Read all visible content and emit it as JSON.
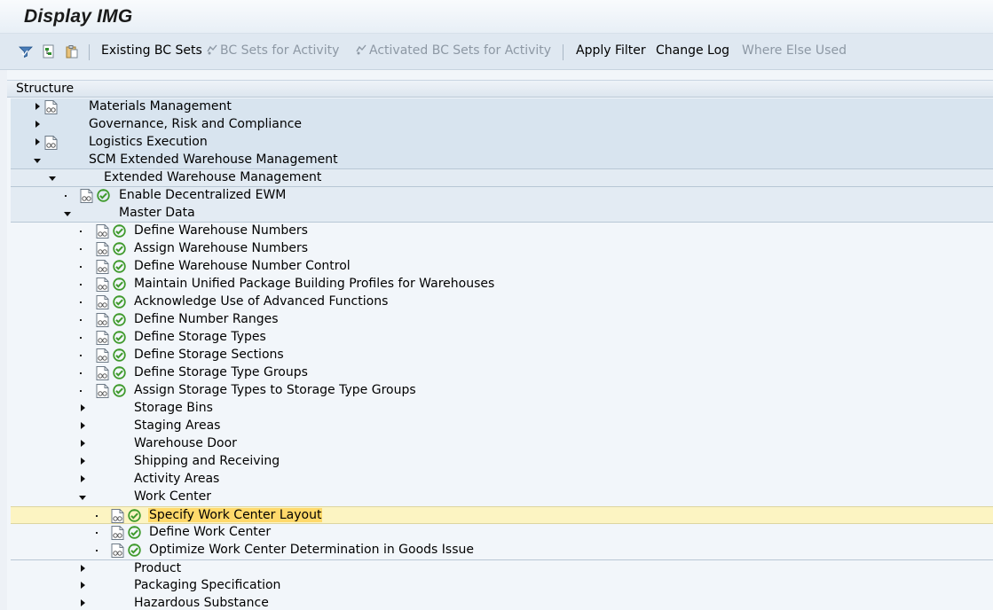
{
  "window": {
    "title": "Display IMG"
  },
  "toolbar": {
    "icons": [
      "expand-filter-icon",
      "subtree-icon",
      "clipboard-icon"
    ],
    "buttons": [
      {
        "label": "Existing BC Sets",
        "enabled": true
      },
      {
        "label": "BC Sets for Activity",
        "enabled": false
      },
      {
        "label": "Activated BC Sets for Activity",
        "enabled": false
      },
      {
        "label": "Apply Filter",
        "enabled": true
      },
      {
        "label": "Change Log",
        "enabled": true
      },
      {
        "label": "Where Else Used",
        "enabled": false
      }
    ]
  },
  "structure": {
    "header": "Structure",
    "rows": [
      {
        "label": "Materials Management",
        "level": 0,
        "expander": "collapsed",
        "doc_icon": true,
        "exec_icon": false
      },
      {
        "label": "Governance, Risk and Compliance",
        "level": 0,
        "expander": "collapsed",
        "doc_icon": false,
        "exec_icon": false
      },
      {
        "label": "Logistics Execution",
        "level": 0,
        "expander": "collapsed",
        "doc_icon": true,
        "exec_icon": false
      },
      {
        "label": "SCM Extended Warehouse Management",
        "level": 0,
        "expander": "expanded",
        "doc_icon": false,
        "exec_icon": false
      },
      {
        "label": "Extended Warehouse Management",
        "level": 1,
        "expander": "expanded",
        "doc_icon": false,
        "exec_icon": false
      },
      {
        "label": "Enable Decentralized EWM",
        "level": 2,
        "expander": "leaf",
        "doc_icon": true,
        "exec_icon": true
      },
      {
        "label": "Master Data",
        "level": 2,
        "expander": "expanded",
        "doc_icon": false,
        "exec_icon": false
      },
      {
        "label": "Define Warehouse Numbers",
        "level": 3,
        "expander": "leaf",
        "doc_icon": true,
        "exec_icon": true
      },
      {
        "label": "Assign Warehouse Numbers",
        "level": 3,
        "expander": "leaf",
        "doc_icon": true,
        "exec_icon": true
      },
      {
        "label": "Define Warehouse Number Control",
        "level": 3,
        "expander": "leaf",
        "doc_icon": true,
        "exec_icon": true
      },
      {
        "label": "Maintain Unified Package Building Profiles for Warehouses",
        "level": 3,
        "expander": "leaf",
        "doc_icon": true,
        "exec_icon": true
      },
      {
        "label": "Acknowledge Use of Advanced Functions",
        "level": 3,
        "expander": "leaf",
        "doc_icon": true,
        "exec_icon": true
      },
      {
        "label": "Define Number Ranges",
        "level": 3,
        "expander": "leaf",
        "doc_icon": true,
        "exec_icon": true
      },
      {
        "label": "Define Storage Types",
        "level": 3,
        "expander": "leaf",
        "doc_icon": true,
        "exec_icon": true
      },
      {
        "label": "Define Storage Sections",
        "level": 3,
        "expander": "leaf",
        "doc_icon": true,
        "exec_icon": true
      },
      {
        "label": "Define Storage Type Groups",
        "level": 3,
        "expander": "leaf",
        "doc_icon": true,
        "exec_icon": true
      },
      {
        "label": "Assign Storage Types to Storage Type Groups",
        "level": 3,
        "expander": "leaf",
        "doc_icon": true,
        "exec_icon": true
      },
      {
        "label": "Storage Bins",
        "level": 3,
        "expander": "collapsed",
        "doc_icon": false,
        "exec_icon": false
      },
      {
        "label": "Staging Areas",
        "level": 3,
        "expander": "collapsed",
        "doc_icon": false,
        "exec_icon": false
      },
      {
        "label": "Warehouse Door",
        "level": 3,
        "expander": "collapsed",
        "doc_icon": false,
        "exec_icon": false
      },
      {
        "label": "Shipping and Receiving",
        "level": 3,
        "expander": "collapsed",
        "doc_icon": false,
        "exec_icon": false
      },
      {
        "label": "Activity Areas",
        "level": 3,
        "expander": "collapsed",
        "doc_icon": false,
        "exec_icon": false
      },
      {
        "label": "Work Center",
        "level": 3,
        "expander": "expanded",
        "doc_icon": false,
        "exec_icon": false
      },
      {
        "label": "Specify Work Center Layout",
        "level": 4,
        "expander": "leaf",
        "doc_icon": true,
        "exec_icon": true,
        "selected": true
      },
      {
        "label": "Define Work Center",
        "level": 4,
        "expander": "leaf",
        "doc_icon": true,
        "exec_icon": true
      },
      {
        "label": "Optimize Work Center Determination in Goods Issue",
        "level": 4,
        "expander": "leaf",
        "doc_icon": true,
        "exec_icon": true
      },
      {
        "label": "Product",
        "level": 3,
        "expander": "collapsed",
        "doc_icon": false,
        "exec_icon": false
      },
      {
        "label": "Packaging Specification",
        "level": 3,
        "expander": "collapsed",
        "doc_icon": false,
        "exec_icon": false
      },
      {
        "label": "Hazardous Substance",
        "level": 3,
        "expander": "collapsed",
        "doc_icon": false,
        "exec_icon": false
      }
    ]
  },
  "colors": {
    "selected_bg": "#fcf4c2",
    "selected_label_bg": "#ffd96b",
    "exec_icon": "#3f9a2c",
    "toolbar_bg": "#dfe8f1"
  }
}
